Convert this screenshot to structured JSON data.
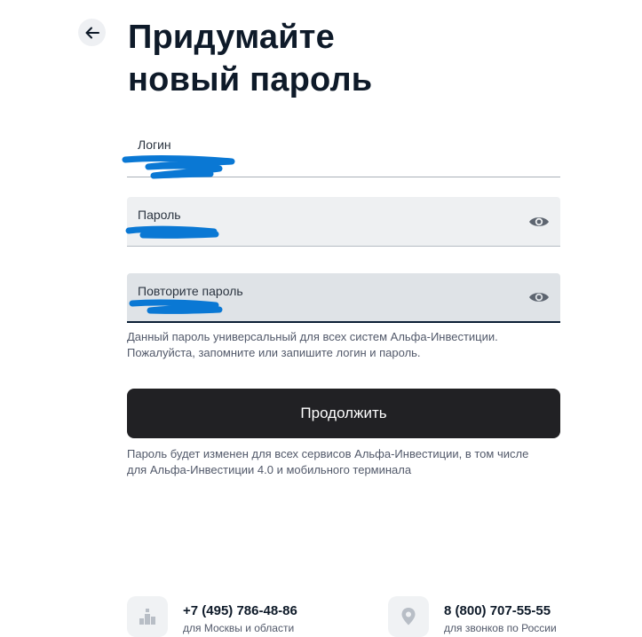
{
  "header": {
    "title_line1": "Придумайте",
    "title_line2": "новый пароль"
  },
  "form": {
    "login": {
      "label": "Логин",
      "value": ""
    },
    "password": {
      "label": "Пароль",
      "value": ""
    },
    "repeat_password": {
      "label": "Повторите пароль",
      "value": ""
    },
    "hint_universal_line1": "Данный пароль универсальный для всех систем Альфа-Инвестиции.",
    "hint_universal_line2": "Пожалуйста, запомните или запишите логин и пароль.",
    "continue_label": "Продолжить",
    "hint_changed_line1": "Пароль будет изменен для всех сервисов Альфа-Инвестиции, в том числе",
    "hint_changed_line2": "для Альфа-Инвестиции 4.0 и мобильного терминала"
  },
  "contacts": [
    {
      "phone": "+7 (495) 786-48-86",
      "description": "для Москвы и области",
      "icon": "city-icon"
    },
    {
      "phone": "8 (800) 707-55-55",
      "description": "для звонков по России",
      "icon": "location-pin-icon"
    }
  ],
  "colors": {
    "primary_button": "#212124",
    "scribble": "#0a78d4",
    "input_background": "#eef0f2"
  },
  "icons": {
    "back": "arrow-left-icon",
    "show_password": "eye-icon"
  }
}
